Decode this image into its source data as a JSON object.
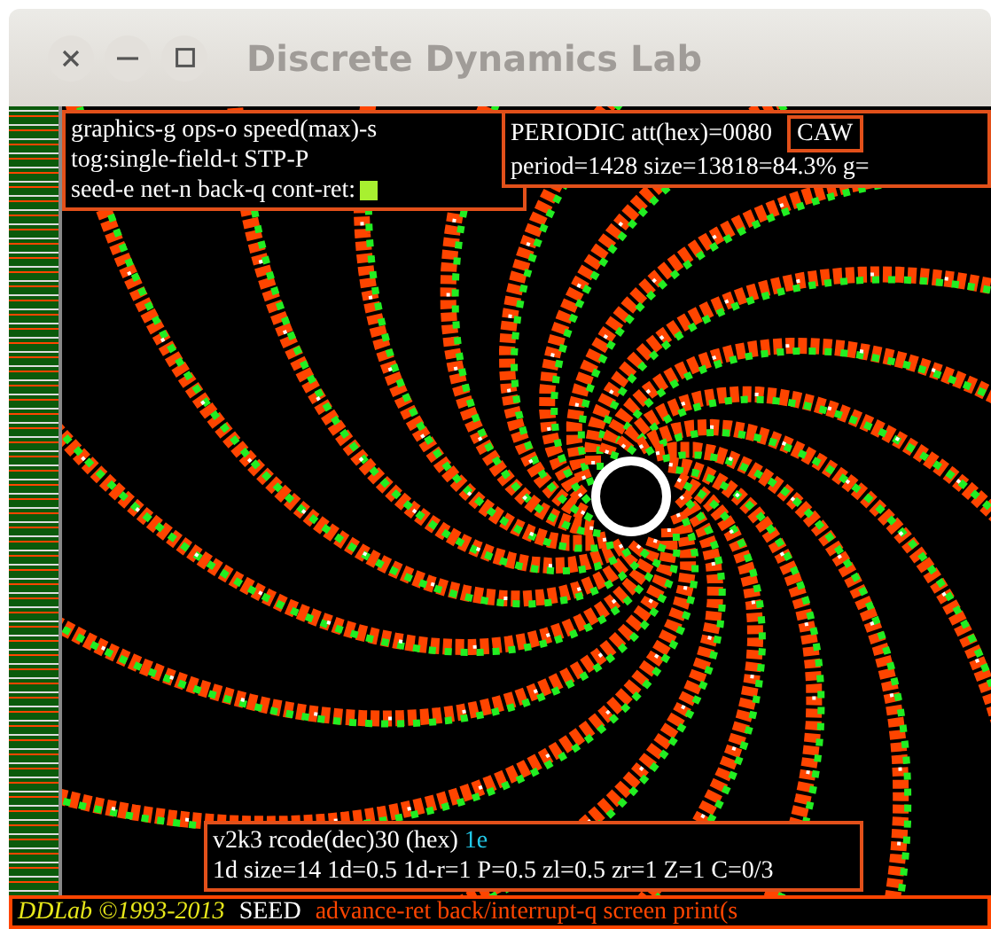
{
  "window": {
    "title": "Discrete Dynamics Lab"
  },
  "help_panel": {
    "lines": [
      "graphics-g ops-o speed(max)-s",
      "tog:single-field-t STP-P",
      "seed-e net-n back-q cont-ret:"
    ]
  },
  "attractor_panel": {
    "label": "PERIODIC att(hex)=",
    "value": "0080",
    "details": "period=1428 size=13818=84.3% g=",
    "badge": "CAW"
  },
  "rule_panel": {
    "rcode": "v2k3 rcode(dec)30  (hex)",
    "hex": "1e",
    "params": "1d size=14 1d=0.5 1d-r=1 P=0.5 zl=0.5 zr=1 Z=1 C=0/3"
  },
  "status_bar": {
    "credit": "DDLab ©1993-2013",
    "mode": "SEED",
    "hint": "advance-ret back/interrupt-q  screen print(s"
  }
}
